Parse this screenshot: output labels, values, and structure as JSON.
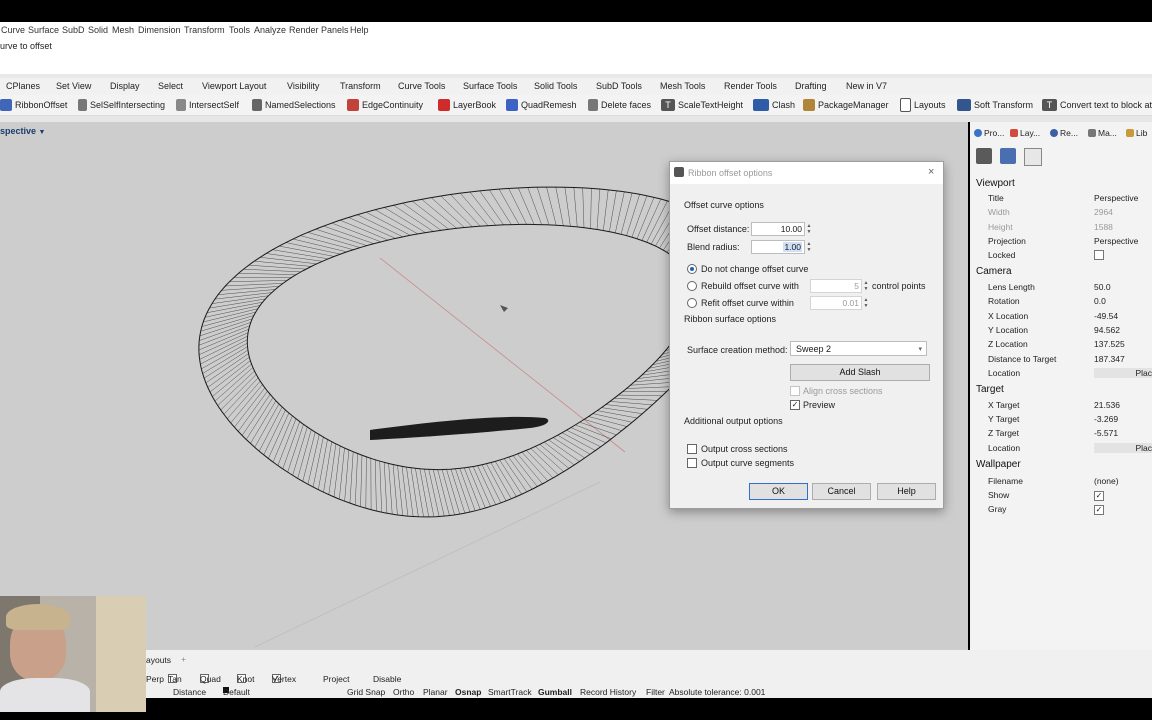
{
  "menu": [
    "Curve",
    "Surface",
    "SubD",
    "Solid",
    "Mesh",
    "Dimension",
    "Transform",
    "Tools",
    "Analyze",
    "Render",
    "Panels",
    "Help"
  ],
  "command_prompt": "urve to offset",
  "tabs": [
    "CPlanes",
    "Set View",
    "Display",
    "Select",
    "Viewport Layout",
    "Visibility",
    "Transform",
    "Curve Tools",
    "Surface Tools",
    "Solid Tools",
    "SubD Tools",
    "Mesh Tools",
    "Render Tools",
    "Drafting",
    "New in V7"
  ],
  "toolbar": {
    "items": [
      "RibbonOffset",
      "SelSelfIntersecting",
      "IntersectSelf",
      "NamedSelections",
      "EdgeContinuity",
      "LayerBook",
      "QuadRemesh",
      "Delete faces",
      "ScaleTextHeight",
      "Clash",
      "PackageManager",
      "Layouts",
      "Soft Transform",
      "Convert text to block at"
    ]
  },
  "viewport": {
    "title": "spective",
    "title_arrow": "▼"
  },
  "dialog": {
    "title": "Ribbon offset options",
    "close": "×",
    "section_offset": "Offset curve options",
    "offset_distance_label": "Offset distance:",
    "offset_distance_value": "10.00",
    "blend_radius_label": "Blend radius:",
    "blend_radius_value": "1.00",
    "opt_no_change": "Do not change offset curve",
    "opt_rebuild": "Rebuild offset curve with",
    "rebuild_value": "5",
    "control_points": "control points",
    "opt_refit": "Refit offset curve within",
    "refit_value": "0.01",
    "section_ribbon": "Ribbon surface options",
    "surface_method_label": "Surface creation method:",
    "surface_method_value": "Sweep 2",
    "add_slash": "Add Slash",
    "align_cross": "Align cross sections",
    "preview": "Preview",
    "section_additional": "Additional output options",
    "output_cross": "Output cross sections",
    "output_segments": "Output curve segments",
    "ok": "OK",
    "cancel": "Cancel",
    "help": "Help"
  },
  "panel": {
    "tabs": [
      "Pro...",
      "Lay...",
      "Re...",
      "Ma...",
      "Lib"
    ],
    "viewport_head": "Viewport",
    "title_label": "Title",
    "title_value": "Perspective",
    "width_label": "Width",
    "width_value": "2964",
    "height_label": "Height",
    "height_value": "1588",
    "projection_label": "Projection",
    "projection_value": "Perspective",
    "locked_label": "Locked",
    "camera_head": "Camera",
    "lens_label": "Lens Length",
    "lens_value": "50.0",
    "rotation_label": "Rotation",
    "rotation_value": "0.0",
    "xloc_label": "X Location",
    "xloc_value": "-49.54",
    "yloc_label": "Y Location",
    "yloc_value": "94.562",
    "zloc_label": "Z Location",
    "zloc_value": "137.525",
    "dist_label": "Distance to Target",
    "dist_value": "187.347",
    "location_label": "Location",
    "place_btn": "Plac",
    "target_head": "Target",
    "xt_label": "X Target",
    "xt_value": "21.536",
    "yt_label": "Y Target",
    "yt_value": "-3.269",
    "zt_label": "Z Target",
    "zt_value": "-5.571",
    "tlocation_label": "Location",
    "tplace_btn": "Plac",
    "wallpaper_head": "Wallpaper",
    "filename_label": "Filename",
    "filename_value": "(none)",
    "show_label": "Show",
    "gray_label": "Gray"
  },
  "status": {
    "layouts_tab": "ayouts",
    "plus": "+",
    "perp": "Perp",
    "tan": "Tan",
    "quad": "Quad",
    "knot": "Knot",
    "vertex": "Vertex",
    "project": "Project",
    "disable": "Disable",
    "distance": "Distance",
    "default_layer": "Default",
    "grid_snap": "Grid Snap",
    "ortho": "Ortho",
    "planar": "Planar",
    "osnap": "Osnap",
    "smarttrack": "SmartTrack",
    "gumball": "Gumball",
    "record_history": "Record History",
    "filter": "Filter",
    "tolerance": "Absolute tolerance: 0.001"
  },
  "colors": {
    "viewport_bg": "#cdcdcd",
    "accent": "#1f5fbf"
  }
}
